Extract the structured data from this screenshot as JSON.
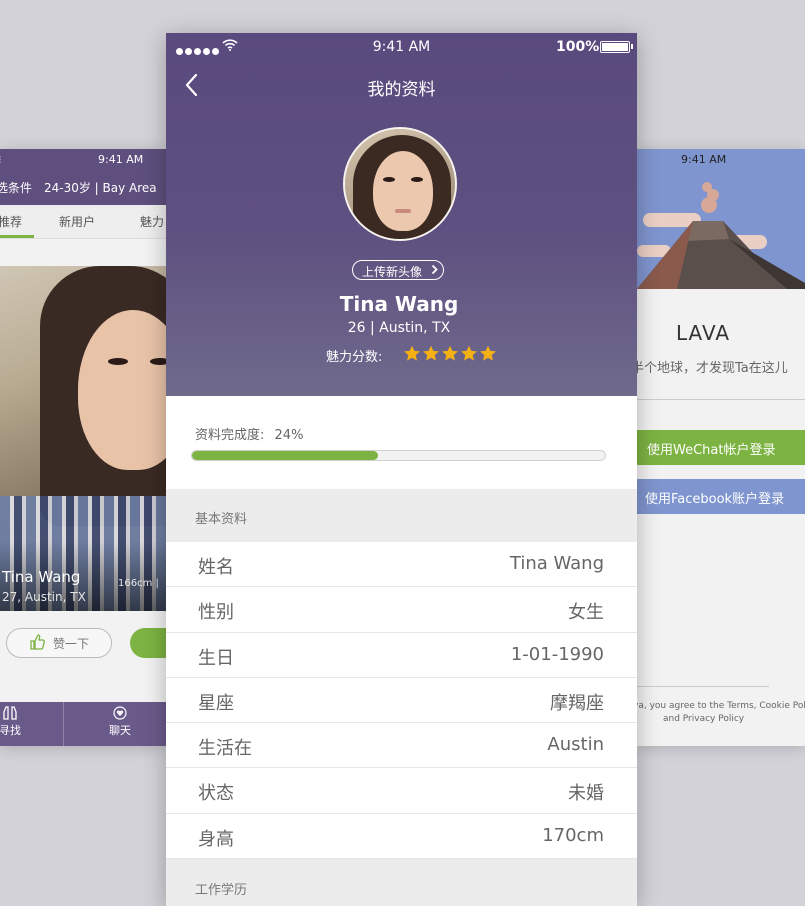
{
  "colors": {
    "accent_green": "#7cb342",
    "header_purple": "#5a4a7e",
    "facebook_blue": "#7f95cf",
    "star_gold": "#f5b014"
  },
  "left_phone": {
    "status_time": "9:41 AM",
    "filter_label": "选条件",
    "filter_value": "24-30岁 | Bay Area",
    "tabs": [
      "推荐",
      "新用户",
      "魅力"
    ],
    "card": {
      "name": "Tina Wang",
      "info": "27, Austin, TX",
      "height": "166cm |"
    },
    "like_button": "赞一下",
    "bottom_nav": [
      {
        "label": "寻找",
        "icon": "binoculars-icon"
      },
      {
        "label": "聊天",
        "icon": "chat-heart-icon"
      }
    ]
  },
  "right_phone": {
    "status_time": "9:41 AM",
    "brand": "LAVA",
    "tagline": "半个地球，才发现Ta在这儿",
    "wechat_login": "使用WeChat帐户登录",
    "facebook_login": "使用Facebook账户登录",
    "terms_line1": "va, you agree to the Terms, Cookie Poli",
    "terms_line2": "and Privacy Policy"
  },
  "center_phone": {
    "status": {
      "time": "9:41 AM",
      "battery": "100%"
    },
    "title": "我的资料",
    "upload_avatar": "上传新头像",
    "name": "Tina Wang",
    "subinfo": "26 | Austin, TX",
    "charm_label": "魅力分数:",
    "charm_stars": 5,
    "completion_label": "资料完成度:",
    "completion_value": "24%",
    "completion_fraction": 0.45,
    "basic_section": "基本资料",
    "profile_rows": [
      {
        "key": "姓名",
        "value": "Tina Wang"
      },
      {
        "key": "性别",
        "value": "女生"
      },
      {
        "key": "生日",
        "value": "1-01-1990"
      },
      {
        "key": "星座",
        "value": "摩羯座"
      },
      {
        "key": "生活在",
        "value": "Austin"
      },
      {
        "key": "状态",
        "value": "未婚"
      },
      {
        "key": "身高",
        "value": "170cm"
      }
    ],
    "work_section": "工作学历"
  }
}
